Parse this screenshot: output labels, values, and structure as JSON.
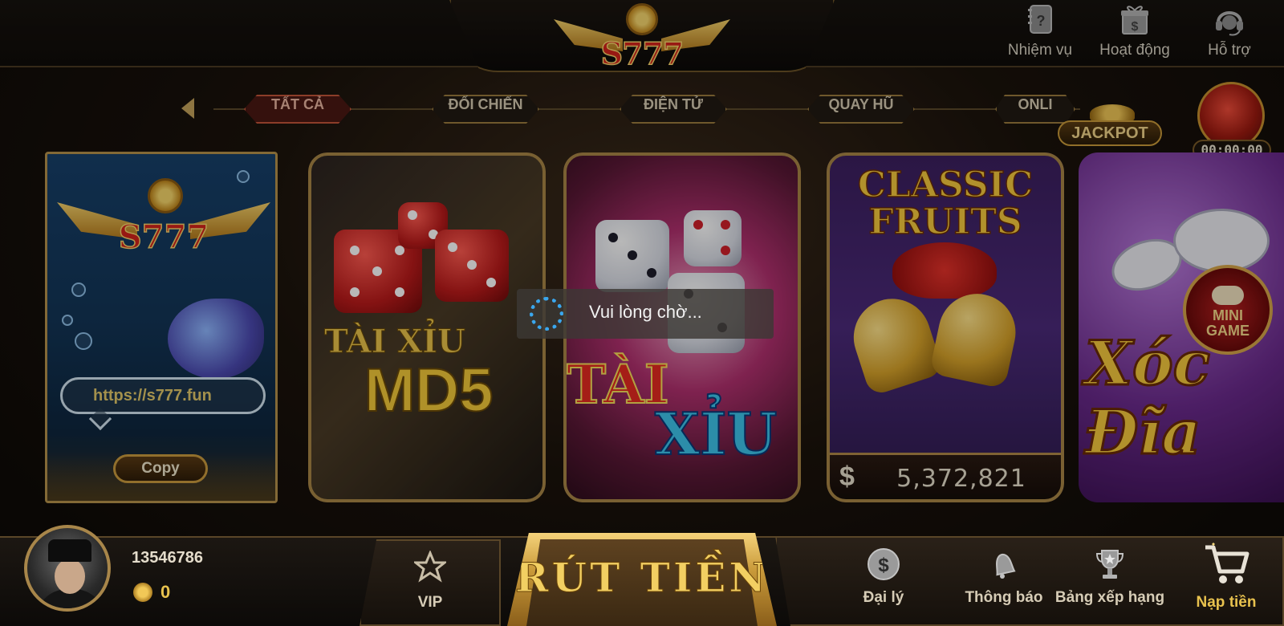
{
  "header": {
    "logo_text": "S777",
    "actions": [
      {
        "label": "Nhiệm vụ",
        "icon": "quest-book-icon"
      },
      {
        "label": "Hoạt động",
        "icon": "gift-box-icon"
      },
      {
        "label": "Hỗ trợ",
        "icon": "headset-icon"
      }
    ]
  },
  "tabs": {
    "items": [
      "TẤT CẢ",
      "ĐỐI CHIẾN",
      "ĐIỆN TỬ",
      "QUAY HŨ",
      "ONLI"
    ],
    "active": "TẤT CẢ"
  },
  "jackpot": {
    "label": "JACKPOT"
  },
  "gift_timer": {
    "time": "00:00:00"
  },
  "promo_card": {
    "logo_text": "S777",
    "url": "https://s777.fun",
    "copy_label": "Copy"
  },
  "games": [
    {
      "title_line1": "TÀI XỈU",
      "title_line2": "MD5"
    },
    {
      "title_line1": "TÀI",
      "title_line2": "XỈU"
    },
    {
      "title_line1": "CLASSIC",
      "title_line2": "FRUITS",
      "currency": "$",
      "jackpot_amount": "5,372,821"
    },
    {
      "title": "Xóc Đĩa",
      "badge_line1": "MINI",
      "badge_line2": "GAME"
    }
  ],
  "loading": {
    "text": "Vui lòng chờ..."
  },
  "user": {
    "id": "13546786",
    "balance": "0"
  },
  "bottom_nav": {
    "vip": "VIP",
    "withdraw": "RÚT TIỀN",
    "agent": "Đại lý",
    "notifications": "Thông báo",
    "leaderboard": "Bảng xếp hạng",
    "deposit": "Nạp tiền"
  },
  "colors": {
    "gold": "#e8c24e",
    "active_tab": "#4a1812",
    "spinner": "#3aa7ee"
  }
}
